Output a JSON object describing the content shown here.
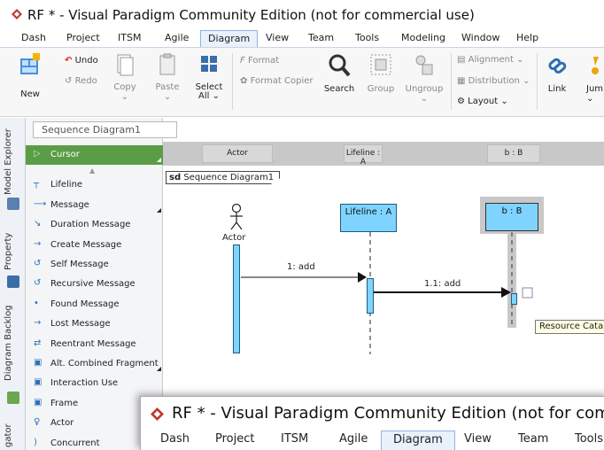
{
  "window": {
    "title": "RF * - Visual Paradigm Community Edition (not for commercial use)"
  },
  "menu": [
    "Dash",
    "Project",
    "ITSM",
    "Agile",
    "Diagram",
    "View",
    "Team",
    "Tools",
    "Modeling",
    "Window",
    "Help"
  ],
  "menu_active": "Diagram",
  "ribbon": {
    "new": "New",
    "undo": "Undo",
    "redo": "Redo",
    "copy": "Copy",
    "paste": "Paste",
    "select_all": "Select\nAll",
    "select_all_line1": "Select",
    "select_all_line2": "All",
    "format": "Format",
    "format_copier": "Format Copier",
    "search": "Search",
    "group": "Group",
    "ungroup": "Ungroup",
    "alignment": "Alignment",
    "distribution": "Distribution",
    "layout": "Layout",
    "link": "Link",
    "jump": "Jum"
  },
  "side_tabs": [
    "Model Explorer",
    "Property",
    "Diagram Backlog",
    "gator"
  ],
  "breadcrumb": "Sequence Diagram1",
  "palette": [
    {
      "label": "Cursor",
      "icon": "cursor-icon"
    },
    {
      "label": "Lifeline",
      "icon": "lifeline-icon"
    },
    {
      "label": "Message",
      "icon": "message-icon"
    },
    {
      "label": "Duration Message",
      "icon": "duration-message-icon"
    },
    {
      "label": "Create Message",
      "icon": "create-message-icon"
    },
    {
      "label": "Self Message",
      "icon": "self-message-icon"
    },
    {
      "label": "Recursive Message",
      "icon": "recursive-message-icon"
    },
    {
      "label": "Found Message",
      "icon": "found-message-icon"
    },
    {
      "label": "Lost Message",
      "icon": "lost-message-icon"
    },
    {
      "label": "Reentrant Message",
      "icon": "reentrant-message-icon"
    },
    {
      "label": "Alt. Combined Fragment",
      "icon": "combined-fragment-icon"
    },
    {
      "label": "Interaction Use",
      "icon": "interaction-use-icon"
    },
    {
      "label": "Frame",
      "icon": "frame-icon"
    },
    {
      "label": "Actor",
      "icon": "actor-icon"
    },
    {
      "label": "Concurrent",
      "icon": "concurrent-icon"
    }
  ],
  "lane_headers": [
    "Actor",
    "Lifeline : A",
    "b : B"
  ],
  "diagram": {
    "frame_label_bold": "sd",
    "frame_label": "Sequence Diagram1",
    "actor_label": "Actor",
    "lifeline_a": "Lifeline : A",
    "lifeline_b": "b : B",
    "msg1": "1: add",
    "msg2": "1.1: add"
  },
  "tooltip": "Resource Catalog",
  "overlay": {
    "title": "RF * - Visual Paradigm Community Edition (not for commerci",
    "menu": [
      "Dash",
      "Project",
      "ITSM",
      "Agile",
      "Diagram",
      "View",
      "Team",
      "Tools"
    ]
  },
  "colors": {
    "lifeline_fill": "#7fd4ff",
    "palette_selected": "#5b9d47",
    "logo_red": "#c0392b"
  }
}
